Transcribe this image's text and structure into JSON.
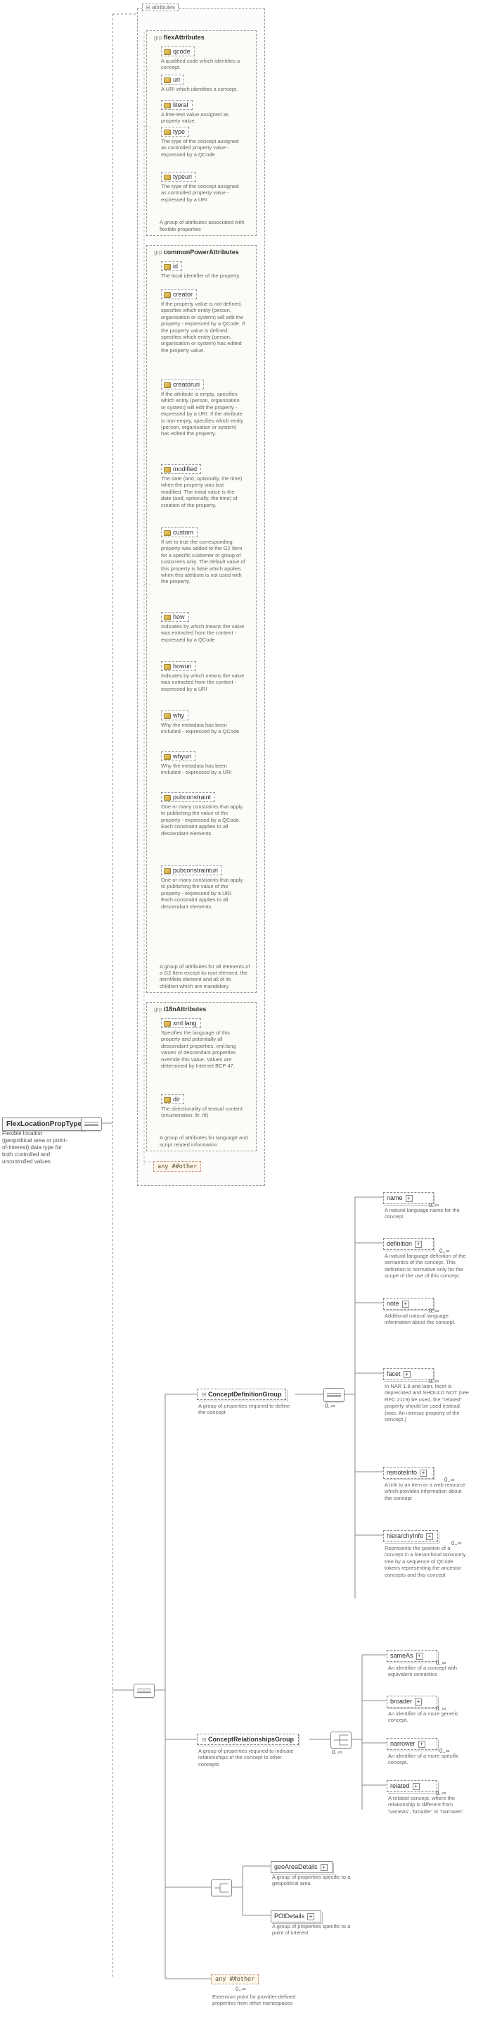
{
  "root": {
    "name": "FlexLocationPropType",
    "desc": "Flexible location (geopolitical area or point-of-interest) data type for both controlled and uncontrolled values"
  },
  "attributes_tab": "attributes",
  "flex": {
    "header": "flexAttributes",
    "group_desc": "A group of attributes associated with flexible properties",
    "items": [
      {
        "name": "qcode",
        "desc": "A qualified code which identifies a concept."
      },
      {
        "name": "uri",
        "desc": "A URI which identifies a concept."
      },
      {
        "name": "literal",
        "desc": "A free-text value assigned as property value."
      },
      {
        "name": "type",
        "desc": "The type of the concept assigned as controlled property value - expressed by a QCode"
      },
      {
        "name": "typeuri",
        "desc": "The type of the concept assigned as controlled property value - expressed by a URI"
      }
    ]
  },
  "common": {
    "header": "commonPowerAttributes",
    "group_desc": "A group of attributes for all elements of a G2 Item except its root element, the itemMeta element and all of its children which are mandatory.",
    "items": [
      {
        "name": "id",
        "desc": "The local identifier of the property."
      },
      {
        "name": "creator",
        "desc": "If the property value is not defined, specifies which entity (person, organisation or system) will edit the property - expressed by a QCode. If the property value is defined, specifies which entity (person, organisation or system) has edited the property value."
      },
      {
        "name": "creatoruri",
        "desc": "If the attribute is empty, specifies which entity (person, organisation or system) will edit the property - expressed by a URI. If the attribute is non-empty, specifies which entity (person, organisation or system) has edited the property."
      },
      {
        "name": "modified",
        "desc": "The date (and, optionally, the time) when the property was last modified. The initial value is the date (and, optionally, the time) of creation of the property."
      },
      {
        "name": "custom",
        "desc": "If set to true the corresponding property was added to the G2 Item for a specific customer or group of customers only. The default value of this property is false which applies when this attribute is not used with the property."
      },
      {
        "name": "how",
        "desc": "Indicates by which means the value was extracted from the content - expressed by a QCode"
      },
      {
        "name": "howuri",
        "desc": "Indicates by which means the value was extracted from the content - expressed by a URI"
      },
      {
        "name": "why",
        "desc": "Why the metadata has been included - expressed by a QCode"
      },
      {
        "name": "whyuri",
        "desc": "Why the metadata has been included - expressed by a URI"
      },
      {
        "name": "pubconstraint",
        "desc": "One or many constraints that apply to publishing the value of the property - expressed by a QCode. Each constraint applies to all descendant elements."
      },
      {
        "name": "pubconstrainturi",
        "desc": "One or many constraints that apply to publishing the value of the property - expressed by a URI. Each constraint applies to all descendant elements."
      }
    ]
  },
  "i18n": {
    "header": "i18nAttributes",
    "group_desc": "A group of attributes for language and script related information",
    "items": [
      {
        "name": "xml:lang",
        "desc": "Specifies the language of this property and potentially all descendant properties. xml:lang values of descendant properties override this value. Values are determined by Internet BCP 47."
      },
      {
        "name": "dir",
        "desc": "The directionality of textual content (enumeration: ltr, rtl)"
      }
    ]
  },
  "any_top": {
    "label": "any ##other"
  },
  "conceptDef": {
    "name": "ConceptDefinitionGroup",
    "desc": "A group of properties required to define the concept",
    "occ": "0..∞",
    "items": [
      {
        "name": "name",
        "desc": "A natural language name for the concept."
      },
      {
        "name": "definition",
        "desc": "A natural language definition of the semantics of the concept. This definition is normative only for the scope of the use of this concept."
      },
      {
        "name": "note",
        "desc": "Additional natural language information about the concept."
      },
      {
        "name": "facet",
        "desc": "In NAR 1.8 and later, facet is deprecated and SHOULD NOT (see RFC 2119) be used, the \"related\" property should be used instead. (was: An intrinsic property of the concept.)"
      },
      {
        "name": "remoteInfo",
        "desc": "A link to an item or a web resource which provides information about the concept"
      },
      {
        "name": "hierarchyInfo",
        "desc": "Represents the position of a concept in a hierarchical taxonomy tree by a sequence of QCode tokens representing the ancestor concepts and this concept"
      }
    ]
  },
  "conceptRel": {
    "name": "ConceptRelationshipsGroup",
    "desc": "A group of properties required to indicate relationships of the concept to other concepts",
    "occ": "0..∞",
    "items": [
      {
        "name": "sameAs",
        "desc": "An identifier of a concept with equivalent semantics"
      },
      {
        "name": "broader",
        "desc": "An identifier of a more generic concept."
      },
      {
        "name": "narrower",
        "desc": "An identifier of a more specific concept."
      },
      {
        "name": "related",
        "desc": "A related concept, where the relationship is different from 'sameAs', 'broader' or 'narrower'."
      }
    ]
  },
  "special": [
    {
      "name": "geoAreaDetails",
      "desc": "A group of properties specific to a geopolitical area"
    },
    {
      "name": "POIDetails",
      "desc": "A group of properties specific to a point of interest"
    }
  ],
  "any_bottom": {
    "label": "any ##other",
    "occ": "0..∞",
    "desc": "Extension point for provider-defined properties from other namespaces"
  }
}
